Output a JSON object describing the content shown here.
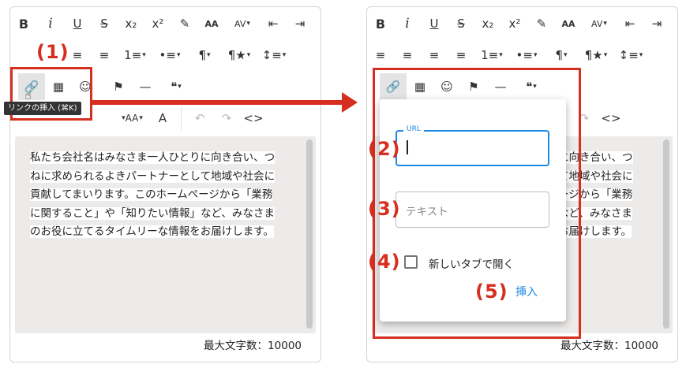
{
  "colors": {
    "annotation": "#d62e1f",
    "accent": "#1e88e5",
    "editor_bg": "#ecebea"
  },
  "editor": {
    "lines": [
      "私たち会社名はみなさま一人ひとりに向き合い、つ",
      "ねに求められるよきパートナーとして地域や社会に",
      "貢献してまいります。このホームページから「業務",
      "に関すること」や「知りたい情報」など、みなさま",
      "のお役に立てるタイムリーな情報をお届けします。"
    ],
    "right_lines": [
      "に向き合い、つ",
      "て地域や社会に",
      "ージから「業務",
      "など、みなさま",
      "お届けします。"
    ],
    "counter": "最大文字数：10000"
  },
  "toolbar": {
    "row1": [
      "B",
      "i",
      "U",
      "S",
      "x₂",
      "x²",
      "✎",
      "AA",
      "AV",
      "⇤",
      "⇥"
    ],
    "row2": [
      "≡",
      "≡",
      "≡",
      "≡",
      "1≡",
      "•≡",
      "¶",
      "¶★",
      "↕≡"
    ],
    "row3": [
      "🔗",
      "▦",
      "☺",
      "⚑",
      "—",
      "❝"
    ],
    "row4": [
      "Aa",
      "A",
      "↶",
      "↷",
      "<>"
    ],
    "left_row4": [
      "AA",
      "A",
      "↶",
      "↷",
      "<>"
    ],
    "caret": "▾"
  },
  "tooltip": "リンクの挿入 (⌘K)",
  "steps": {
    "s1": "(1)",
    "s2": "(2)",
    "s3": "(3)",
    "s4": "(4)",
    "s5": "(5)"
  },
  "popup": {
    "url_label": "URL",
    "text_placeholder": "テキスト",
    "checkbox_label": "新しいタブで開く",
    "insert_label": "挿入"
  },
  "icons": {
    "link": "link-icon",
    "table": "table-icon",
    "emoji": "emoji-icon",
    "flag": "flag-icon",
    "hr": "horizontal-rule-icon",
    "quote": "quote-icon",
    "cursor": "hand-cursor-icon"
  }
}
